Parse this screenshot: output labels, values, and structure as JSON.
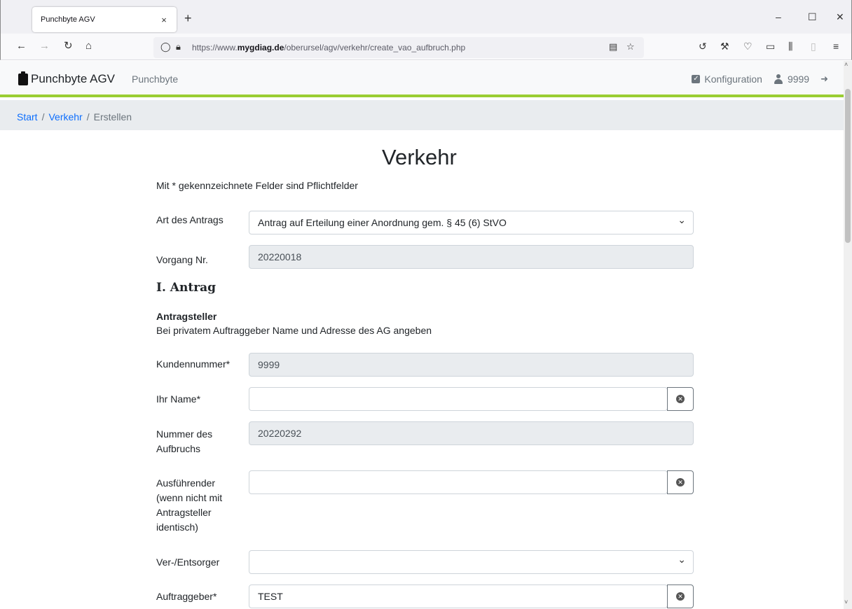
{
  "browser": {
    "tab_title": "Punchbyte AGV",
    "tab_close": "×",
    "new_tab": "+",
    "url_prefix": "https://www.",
    "url_domain": "mygdiag.de",
    "url_path": "/oberursel/agv/verkehr/create_vao_aufbruch.php",
    "win_min": "–",
    "win_max": "☐",
    "win_close": "✕"
  },
  "header": {
    "brand": "Punchbyte AGV",
    "sub_brand": "Punchbyte",
    "config_label": "Konfiguration",
    "user_id": "9999"
  },
  "breadcrumb": {
    "start": "Start",
    "verkehr": "Verkehr",
    "current": "Erstellen",
    "sep": "/"
  },
  "form": {
    "title": "Verkehr",
    "required_note": "Mit * gekennzeichnete Felder sind Pflichtfelder",
    "art_label": "Art des Antrags",
    "art_value": "Antrag auf Erteilung einer Anordnung gem. § 45 (6) StVO",
    "vorgang_label": "Vorgang Nr.",
    "vorgang_value": "20220018",
    "section_title": "I. Antrag",
    "sub_title": "Antragsteller",
    "sub_note": "Bei privatem Auftraggeber Name und Adresse des AG angeben",
    "kunde_label": "Kundennummer*",
    "kunde_value": "9999",
    "name_label": "Ihr Name*",
    "name_value": "",
    "aufbruch_label": "Nummer des Aufbruchs",
    "aufbruch_value": "20220292",
    "ausf_label": "Ausführender (wenn nicht mit Antragsteller identisch)",
    "ausf_value": "",
    "verent_label": "Ver-/Entsorger",
    "verent_value": "",
    "auftrag_label": "Auftraggeber*",
    "auftrag_value": "TEST"
  }
}
